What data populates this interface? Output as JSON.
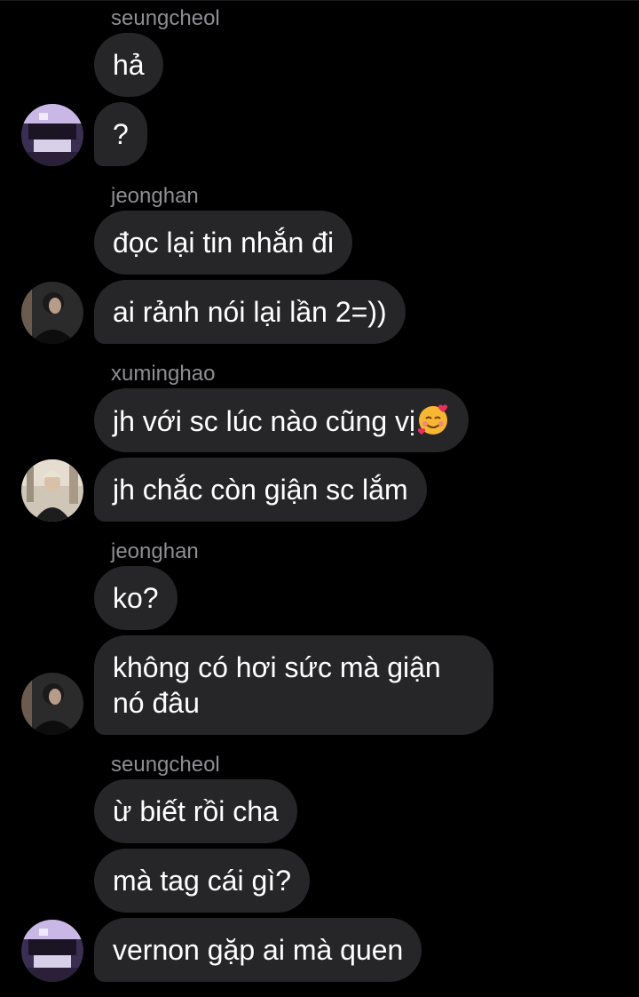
{
  "messages": [
    {
      "sender": "seungcheol",
      "bubbles": [
        "hả",
        "?"
      ]
    },
    {
      "sender": "jeonghan",
      "bubbles": [
        "đọc lại tin nhắn đi",
        "ai rảnh nói lại lần 2=))"
      ]
    },
    {
      "sender": "xuminghao",
      "bubbles": [
        "jh với sc lúc nào cũng vị",
        "jh chắc còn giận sc lắm"
      ],
      "emoji": "smiling-face-with-hearts"
    },
    {
      "sender": "jeonghan",
      "bubbles": [
        "ko?"
      ],
      "multiline": [
        "không có hơi sức mà giận",
        "nó đâu"
      ]
    },
    {
      "sender": "seungcheol",
      "bubbles": [
        "ừ biết rồi cha",
        "mà tag cái gì?",
        "vernon gặp ai mà quen"
      ]
    }
  ],
  "colors": {
    "background": "#000000",
    "bubble": "#262628",
    "sender_name": "#8e8e93",
    "text": "#ffffff"
  }
}
